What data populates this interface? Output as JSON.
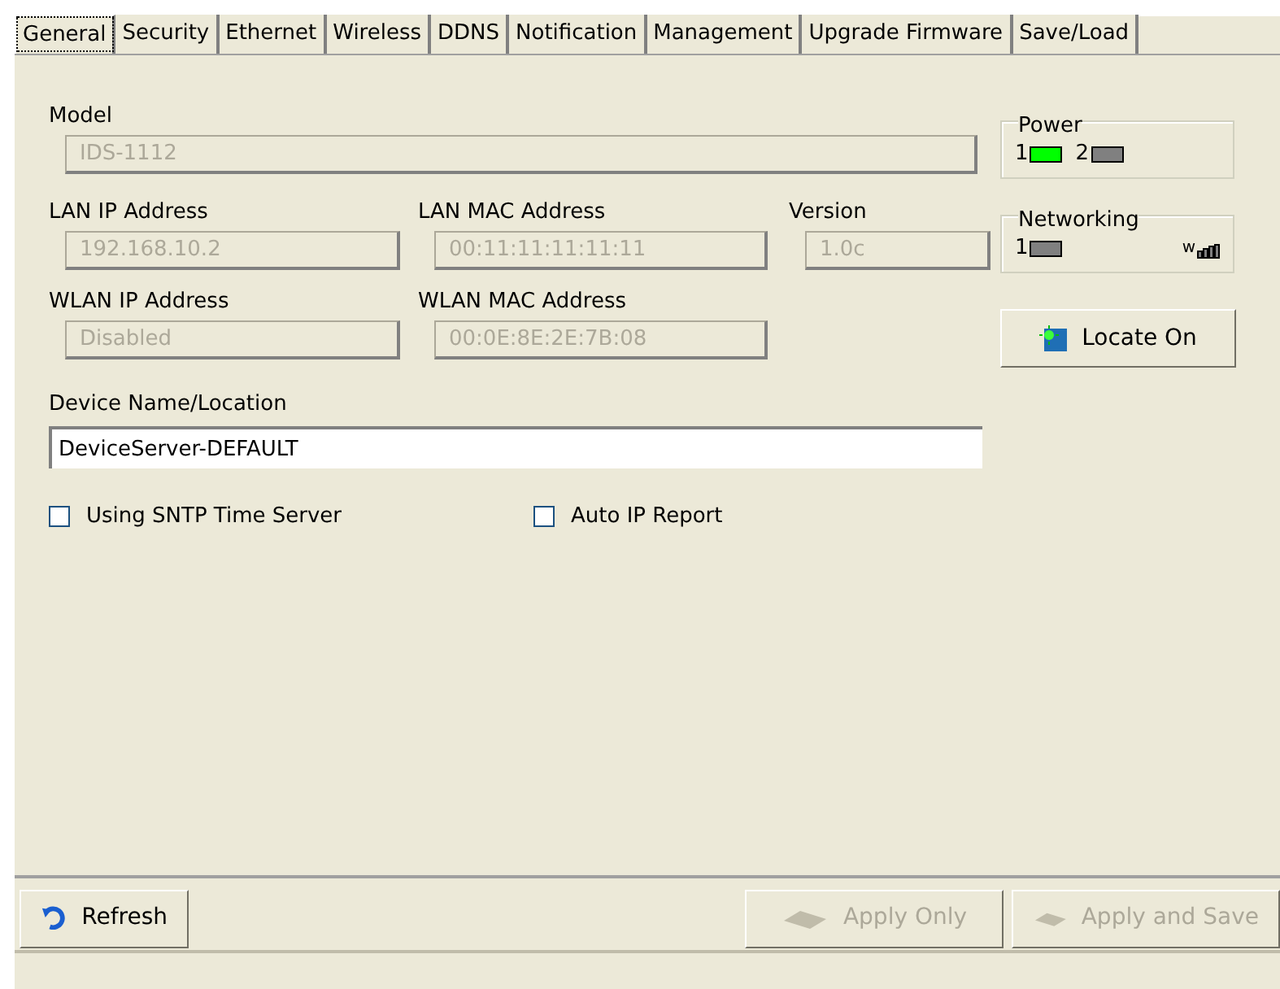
{
  "tabs": [
    {
      "label": "General",
      "selected": true
    },
    {
      "label": "Security",
      "selected": false
    },
    {
      "label": "Ethernet",
      "selected": false
    },
    {
      "label": "Wireless",
      "selected": false
    },
    {
      "label": "DDNS",
      "selected": false
    },
    {
      "label": "Notification",
      "selected": false
    },
    {
      "label": "Management",
      "selected": false
    },
    {
      "label": "Upgrade Firmware",
      "selected": false
    },
    {
      "label": "Save/Load",
      "selected": false
    }
  ],
  "model": {
    "label": "Model",
    "value": "IDS-1112",
    "disabled": true
  },
  "lan_ip": {
    "label": "LAN IP Address",
    "value": "192.168.10.2",
    "disabled": true
  },
  "lan_mac": {
    "label": "LAN MAC Address",
    "value": "00:11:11:11:11:11",
    "disabled": true
  },
  "version": {
    "label": "Version",
    "value": "1.0c",
    "disabled": true
  },
  "wlan_ip": {
    "label": "WLAN IP Address",
    "value": "Disabled",
    "disabled": true
  },
  "wlan_mac": {
    "label": "WLAN MAC Address",
    "value": "00:0E:8E:2E:7B:08",
    "disabled": true
  },
  "device_name": {
    "label": "Device Name/Location",
    "value": "DeviceServer-DEFAULT",
    "disabled": false
  },
  "checkboxes": [
    {
      "label": "Using SNTP Time Server",
      "checked": false
    },
    {
      "label": "Auto IP Report",
      "checked": false
    }
  ],
  "power": {
    "title": "Power",
    "leds": [
      {
        "label": "1",
        "on": true
      },
      {
        "label": "2",
        "on": false
      }
    ]
  },
  "networking": {
    "title": "Networking",
    "leds": [
      {
        "label": "1",
        "on": false
      }
    ],
    "wireless_label": "w"
  },
  "locate_button": {
    "label": "Locate On"
  },
  "buttons": [
    {
      "label": "Refresh",
      "disabled": false
    },
    {
      "label": "Apply Only",
      "disabled": true
    },
    {
      "label": "Apply and Save",
      "disabled": true
    }
  ]
}
